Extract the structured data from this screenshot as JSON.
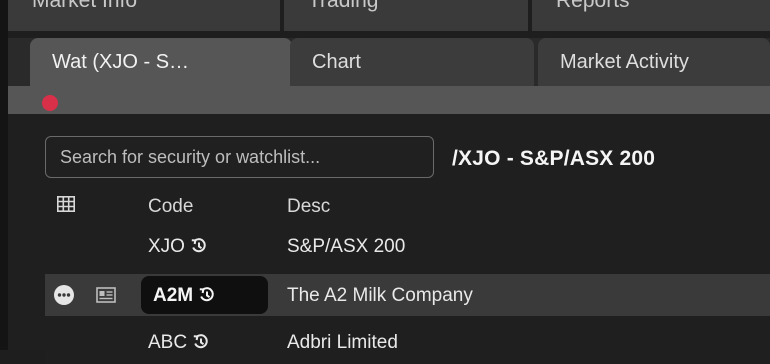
{
  "top_tabs": [
    {
      "label": "Market Info"
    },
    {
      "label": "Trading"
    },
    {
      "label": "Reports"
    }
  ],
  "tabs": [
    {
      "label": "Wat (XJO - S…",
      "active": true
    },
    {
      "label": "Chart",
      "active": false
    },
    {
      "label": "Market Activity",
      "active": false
    }
  ],
  "status_color": "#d9304a",
  "search": {
    "placeholder": "Search for security or watchlist...",
    "value": ""
  },
  "page_title": "/XJO - S&P/ASX 200",
  "table": {
    "grid_icon": "grid-icon",
    "headers": {
      "code": "Code",
      "desc": "Desc"
    },
    "rows": [
      {
        "code": "XJO",
        "desc": "S&P/ASX 200",
        "history_icon": "history-icon",
        "selected": false
      },
      {
        "code": "A2M",
        "desc": "The A2 Milk Company",
        "history_icon": "history-icon",
        "selected": true,
        "row_icons": [
          "more-icon",
          "card-icon"
        ]
      },
      {
        "code": "ABC",
        "desc": "Adbri Limited",
        "history_icon": "history-icon",
        "selected": false
      }
    ]
  }
}
